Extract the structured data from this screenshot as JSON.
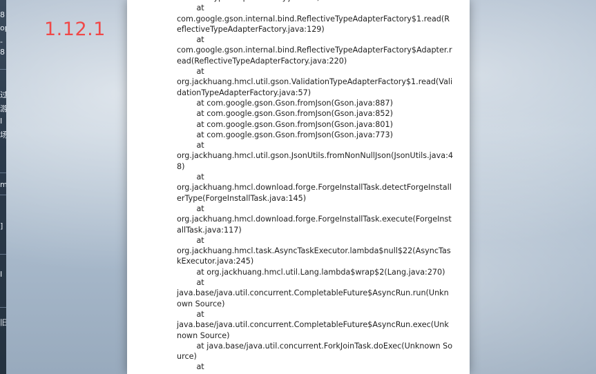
{
  "version_label": "1.12.1",
  "left_strip": {
    "glyphs": [
      "8",
      "op",
      "-",
      "8",
      "过",
      "游",
      "I",
      "场",
      "m",
      "]",
      "I",
      "旧"
    ]
  },
  "dialog": {
    "log_text": "alidationTypeAdapterFactory.java:57)\n        at\ncom.google.gson.internal.bind.ReflectiveTypeAdapterFactory$1.read(ReflectiveTypeAdapterFactory.java:129)\n        at\ncom.google.gson.internal.bind.ReflectiveTypeAdapterFactory$Adapter.read(ReflectiveTypeAdapterFactory.java:220)\n        at\norg.jackhuang.hmcl.util.gson.ValidationTypeAdapterFactory$1.read(ValidationTypeAdapterFactory.java:57)\n        at com.google.gson.Gson.fromJson(Gson.java:887)\n        at com.google.gson.Gson.fromJson(Gson.java:852)\n        at com.google.gson.Gson.fromJson(Gson.java:801)\n        at com.google.gson.Gson.fromJson(Gson.java:773)\n        at\norg.jackhuang.hmcl.util.gson.JsonUtils.fromNonNullJson(JsonUtils.java:48)\n        at\norg.jackhuang.hmcl.download.forge.ForgeInstallTask.detectForgeInstallerType(ForgeInstallTask.java:145)\n        at\norg.jackhuang.hmcl.download.forge.ForgeInstallTask.execute(ForgeInstallTask.java:117)\n        at\norg.jackhuang.hmcl.task.AsyncTaskExecutor.lambda$null$22(AsyncTaskExecutor.java:245)\n        at org.jackhuang.hmcl.util.Lang.lambda$wrap$2(Lang.java:270)\n        at\njava.base/java.util.concurrent.CompletableFuture$AsyncRun.run(Unknown Source)\n        at\njava.base/java.util.concurrent.CompletableFuture$AsyncRun.exec(Unknown Source)\n        at java.base/java.util.concurrent.ForkJoinTask.doExec(Unknown Source)\n        at"
  }
}
